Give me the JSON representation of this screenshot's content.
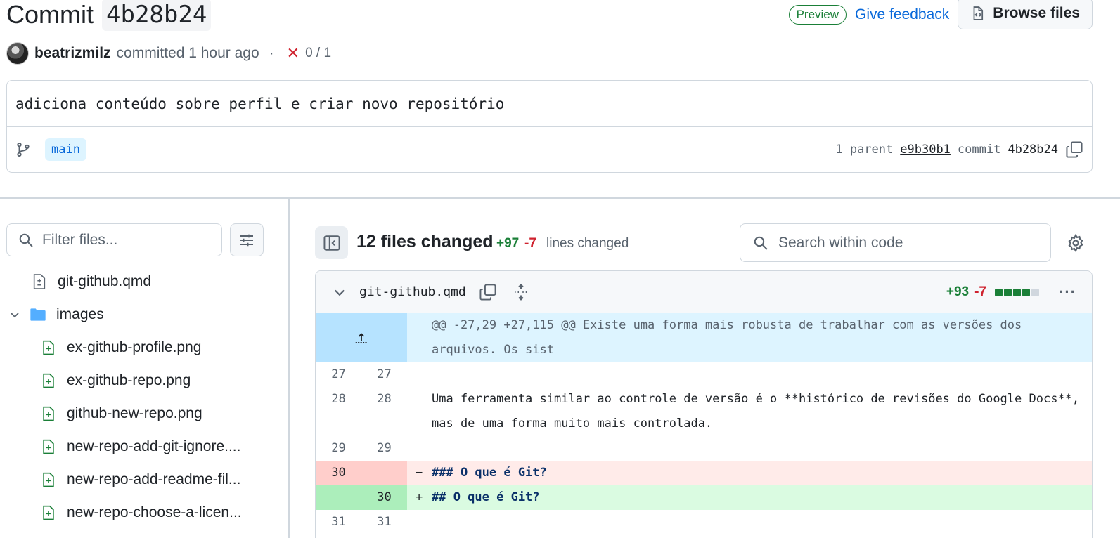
{
  "header": {
    "title_prefix": "Commit",
    "sha": "4b28b24",
    "preview_badge": "Preview",
    "feedback_link": "Give feedback",
    "browse_button": "Browse files"
  },
  "meta": {
    "author": "beatrizmilz",
    "committed_text": "committed 1 hour ago",
    "separator": "·",
    "checks": "0 / 1"
  },
  "commit": {
    "message": "adiciona conteúdo sobre perfil e criar novo repositório",
    "branch": "main",
    "parent_label": "1 parent",
    "parent_sha": "e9b30b1",
    "commit_label": "commit",
    "commit_sha": "4b28b24"
  },
  "sidebar": {
    "filter_placeholder": "Filter files...",
    "tree": [
      {
        "name": "git-github.qmd",
        "type": "modified",
        "indent": 1
      },
      {
        "name": "images",
        "type": "folder",
        "indent": 0
      },
      {
        "name": "ex-github-profile.png",
        "type": "added",
        "indent": 2
      },
      {
        "name": "ex-github-repo.png",
        "type": "added",
        "indent": 2
      },
      {
        "name": "github-new-repo.png",
        "type": "added",
        "indent": 2
      },
      {
        "name": "new-repo-add-git-ignore....",
        "type": "added",
        "indent": 2
      },
      {
        "name": "new-repo-add-readme-fil...",
        "type": "added",
        "indent": 2
      },
      {
        "name": "new-repo-choose-a-licen...",
        "type": "added",
        "indent": 2
      }
    ]
  },
  "diff_summary": {
    "files_changed": "12 files changed",
    "additions": "+97",
    "deletions": "-7",
    "lines_changed": "lines changed",
    "search_placeholder": "Search within code"
  },
  "file": {
    "name": "git-github.qmd",
    "additions": "+93",
    "deletions": "-7",
    "hunk_header": "@@ -27,29 +27,115 @@ Existe uma forma mais robusta de trabalhar com as versões dos arquivos. Os sist",
    "lines": [
      {
        "old": "27",
        "new": "27",
        "type": "context",
        "text": ""
      },
      {
        "old": "28",
        "new": "28",
        "type": "context",
        "text": "Uma ferramenta similar ao controle de versão é o **histórico de revisões do Google Docs**, mas de uma forma muito mais controlada."
      },
      {
        "old": "29",
        "new": "29",
        "type": "context",
        "text": ""
      },
      {
        "old": "30",
        "new": "",
        "type": "del",
        "marker": "−",
        "text": "### O que é Git?"
      },
      {
        "old": "",
        "new": "30",
        "type": "add",
        "marker": "+",
        "text": "## O que é Git?"
      },
      {
        "old": "31",
        "new": "31",
        "type": "context",
        "text": ""
      }
    ]
  },
  "colors": {
    "accent": "#0969da",
    "add": "#1a7f37",
    "del": "#cf222e"
  }
}
